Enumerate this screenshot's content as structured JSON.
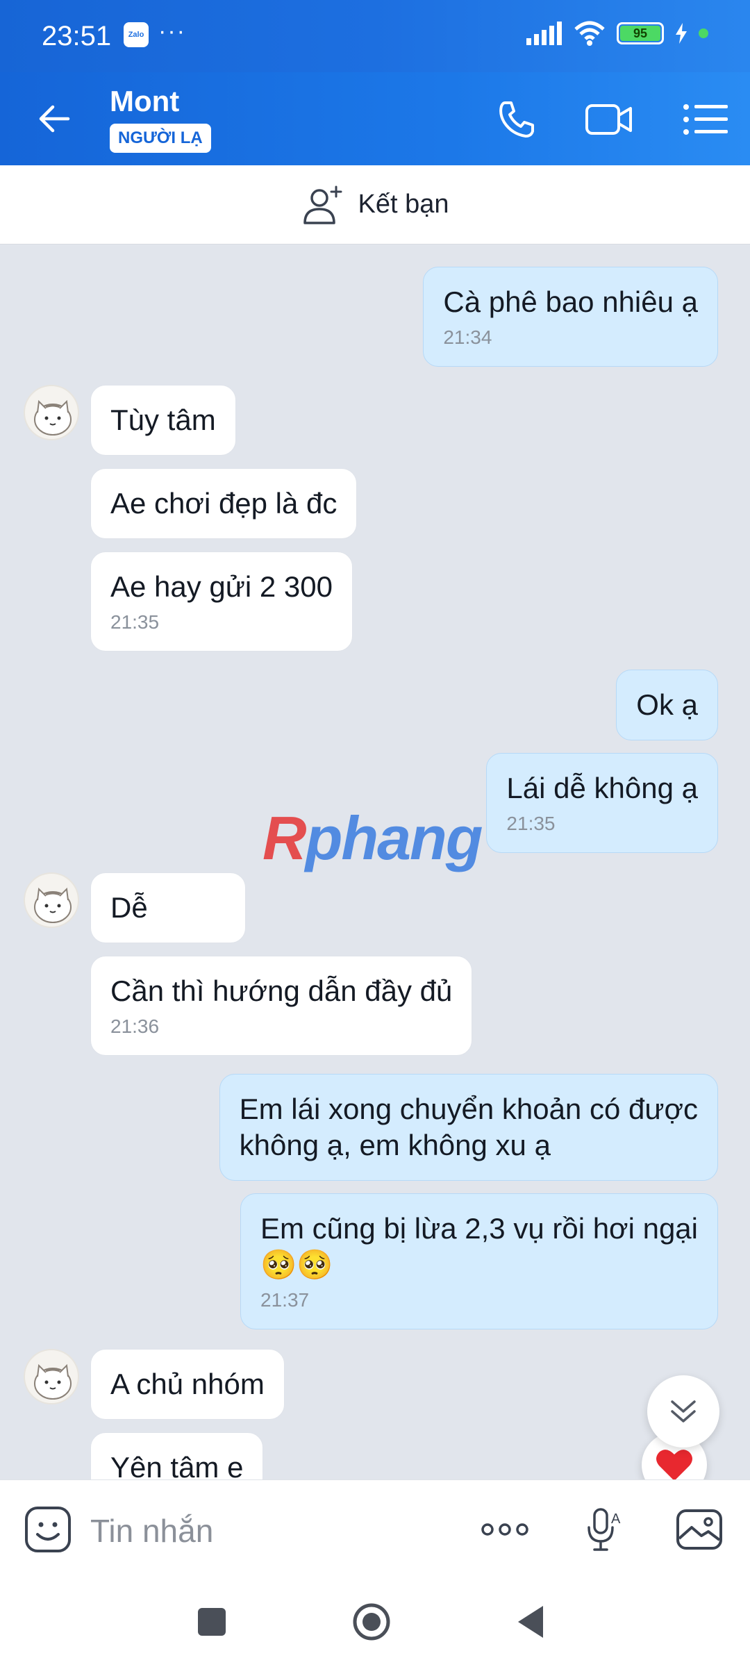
{
  "status_bar": {
    "time": "23:51",
    "app_badge": "Zalo",
    "overflow": "···",
    "battery": "95"
  },
  "header": {
    "contact_name": "Mont",
    "badge": "NGƯỜI LẠ",
    "icons": [
      "back-arrow-icon",
      "phone-icon",
      "video-call-icon",
      "menu-list-icon"
    ]
  },
  "friend_bar": {
    "label": "Kết bạn",
    "icon": "add-user-icon"
  },
  "messages": [
    {
      "dir": "out",
      "text": "Cà phê bao nhiêu ạ",
      "time": "21:34"
    },
    {
      "dir": "in",
      "text": "Tùy tâm"
    },
    {
      "dir": "in",
      "text": "Ae chơi đẹp là đc"
    },
    {
      "dir": "in",
      "text": "Ae hay gửi 2 300",
      "time": "21:35"
    },
    {
      "dir": "out",
      "text": "Ok ạ"
    },
    {
      "dir": "out",
      "text": "Lái dễ không ạ",
      "time": "21:35"
    },
    {
      "dir": "in",
      "text": "Dễ"
    },
    {
      "dir": "in",
      "text": "Cần thì hướng dẫn đầy đủ",
      "time": "21:36"
    },
    {
      "dir": "out",
      "text": "Em lái xong chuyển khoản có được",
      "text2": "không ạ, em không xu ạ"
    },
    {
      "dir": "out",
      "text": "Em cũng bị lừa 2,3 vụ rồi hơi ngại",
      "text2": "🥺🥺",
      "time": "21:37"
    },
    {
      "dir": "in",
      "text": "A chủ nhóm"
    },
    {
      "dir": "in",
      "text": "Yên tâm e"
    }
  ],
  "watermark": {
    "prefix": "R",
    "rest": "phang"
  },
  "composer": {
    "placeholder": "Tin nhắn"
  },
  "colors": {
    "accent": "#1d6fe0",
    "outgoing_bubble": "#d4ecfe",
    "incoming_bubble": "#ffffff",
    "chat_bg": "#e1e5ec"
  }
}
